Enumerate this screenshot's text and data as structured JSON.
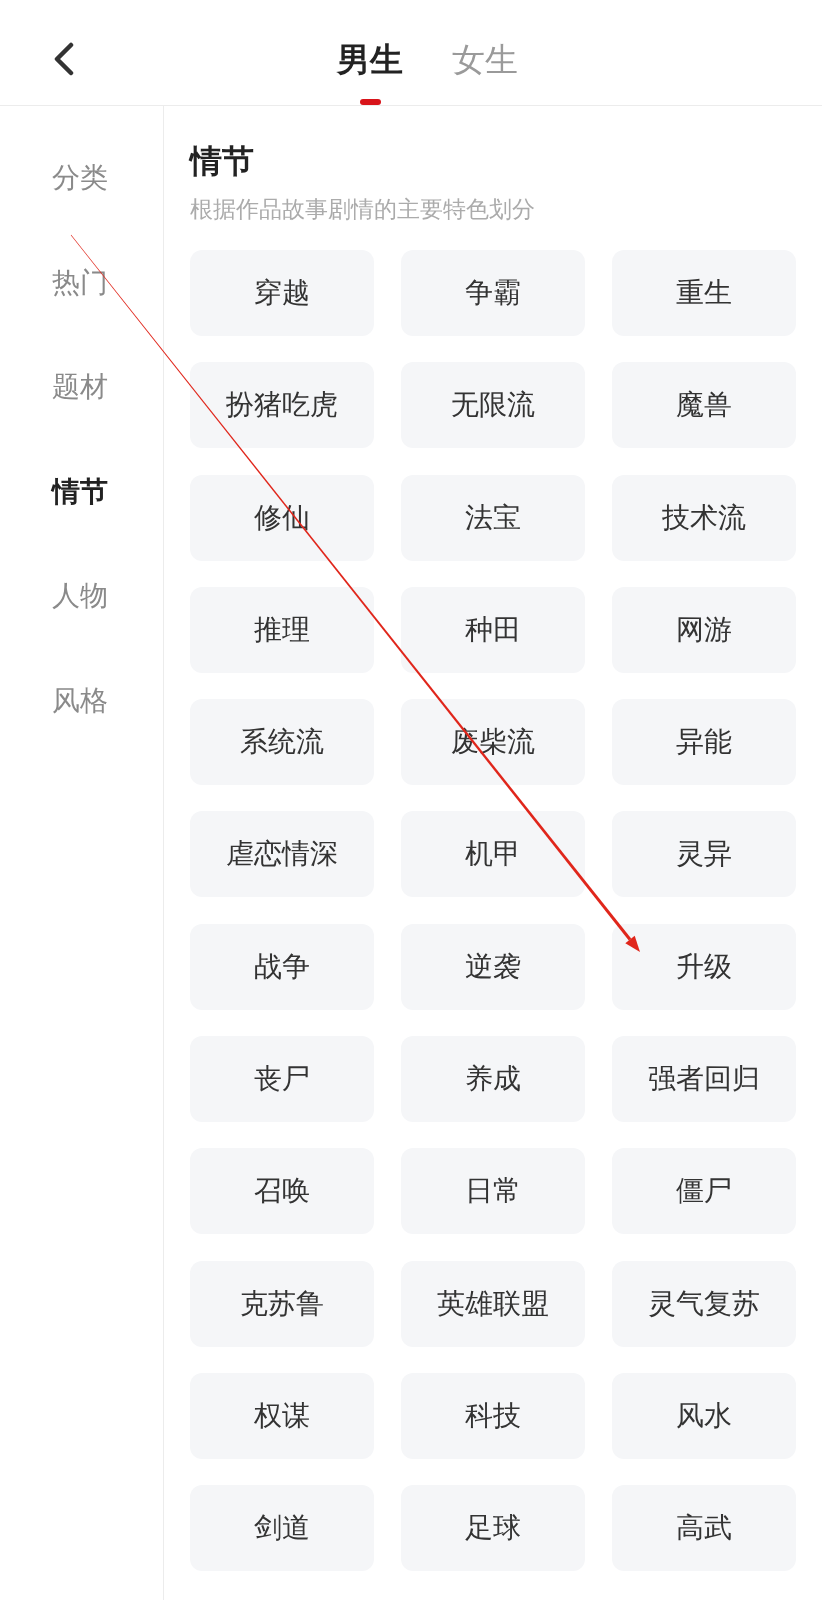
{
  "header": {
    "tabs": [
      {
        "label": "男生",
        "selected": true
      },
      {
        "label": "女生",
        "selected": false
      }
    ]
  },
  "sidebar": {
    "items": [
      {
        "label": "分类",
        "selected": false
      },
      {
        "label": "热门",
        "selected": false
      },
      {
        "label": "题材",
        "selected": false
      },
      {
        "label": "情节",
        "selected": true
      },
      {
        "label": "人物",
        "selected": false
      },
      {
        "label": "风格",
        "selected": false
      }
    ]
  },
  "section": {
    "title": "情节",
    "subtitle": "根据作品故事剧情的主要特色划分",
    "tags": [
      "穿越",
      "争霸",
      "重生",
      "扮猪吃虎",
      "无限流",
      "魔兽",
      "修仙",
      "法宝",
      "技术流",
      "推理",
      "种田",
      "网游",
      "系统流",
      "废柴流",
      "异能",
      "虐恋情深",
      "机甲",
      "灵异",
      "战争",
      "逆袭",
      "升级",
      "丧尸",
      "养成",
      "强者回归",
      "召唤",
      "日常",
      "僵尸",
      "克苏鲁",
      "英雄联盟",
      "灵气复苏",
      "权谋",
      "科技",
      "风水",
      "剑道",
      "足球",
      "高武"
    ]
  }
}
